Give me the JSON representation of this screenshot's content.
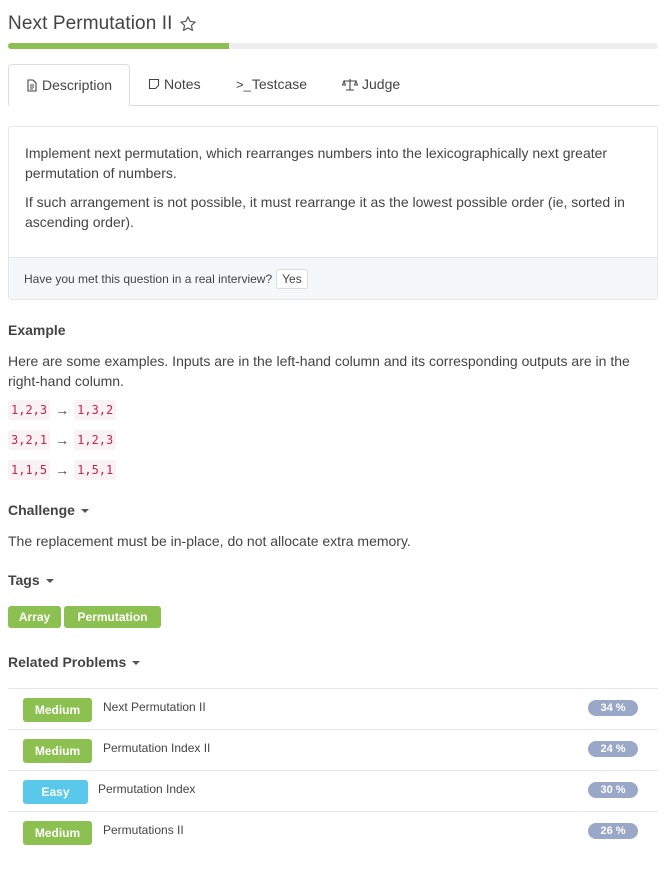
{
  "problem": {
    "title": "Next Permutation II",
    "progress_pct": 34
  },
  "tabs": [
    {
      "label": "Description",
      "icon": "document-icon"
    },
    {
      "label": "Notes",
      "icon": "note-icon"
    },
    {
      "label": "Testcase",
      "icon": ">_"
    },
    {
      "label": "Judge",
      "icon": "scale-icon"
    }
  ],
  "description": {
    "p1": "Implement next permutation, which rearranges numbers into the lexicographically next greater permutation of numbers.",
    "p2": "If such arrangement is not possible, it must rearrange it as the lowest possible order (ie, sorted in ascending order).",
    "interview_question": "Have you met this question in a real interview?",
    "yes_label": "Yes"
  },
  "example": {
    "heading": "Example",
    "text": "Here are some examples. Inputs are in the left-hand column and its corresponding outputs are in the right-hand column.",
    "rows": [
      {
        "input": "1,2,3",
        "arrow": "→",
        "output": "1,3,2"
      },
      {
        "input": "3,2,1",
        "arrow": "→",
        "output": "1,2,3"
      },
      {
        "input": "1,1,5",
        "arrow": "→",
        "output": "1,5,1"
      }
    ]
  },
  "challenge": {
    "heading": "Challenge",
    "text": "The replacement must be in-place, do not allocate extra memory."
  },
  "tags": {
    "heading": "Tags",
    "items": [
      "Array",
      "Permutation"
    ]
  },
  "related": {
    "heading": "Related Problems",
    "items": [
      {
        "difficulty": "Medium",
        "title": "Next Permutation II",
        "rate": "34 %"
      },
      {
        "difficulty": "Medium",
        "title": "Permutation Index II",
        "rate": "24 %"
      },
      {
        "difficulty": "Easy",
        "title": "Permutation Index",
        "rate": "30 %"
      },
      {
        "difficulty": "Medium",
        "title": "Permutations II",
        "rate": "26 %"
      }
    ]
  },
  "colors": {
    "green": "#8cc152",
    "easy_blue": "#5ac8ea",
    "rate_badge": "#9aa8c7",
    "code_red": "#c7254e"
  }
}
